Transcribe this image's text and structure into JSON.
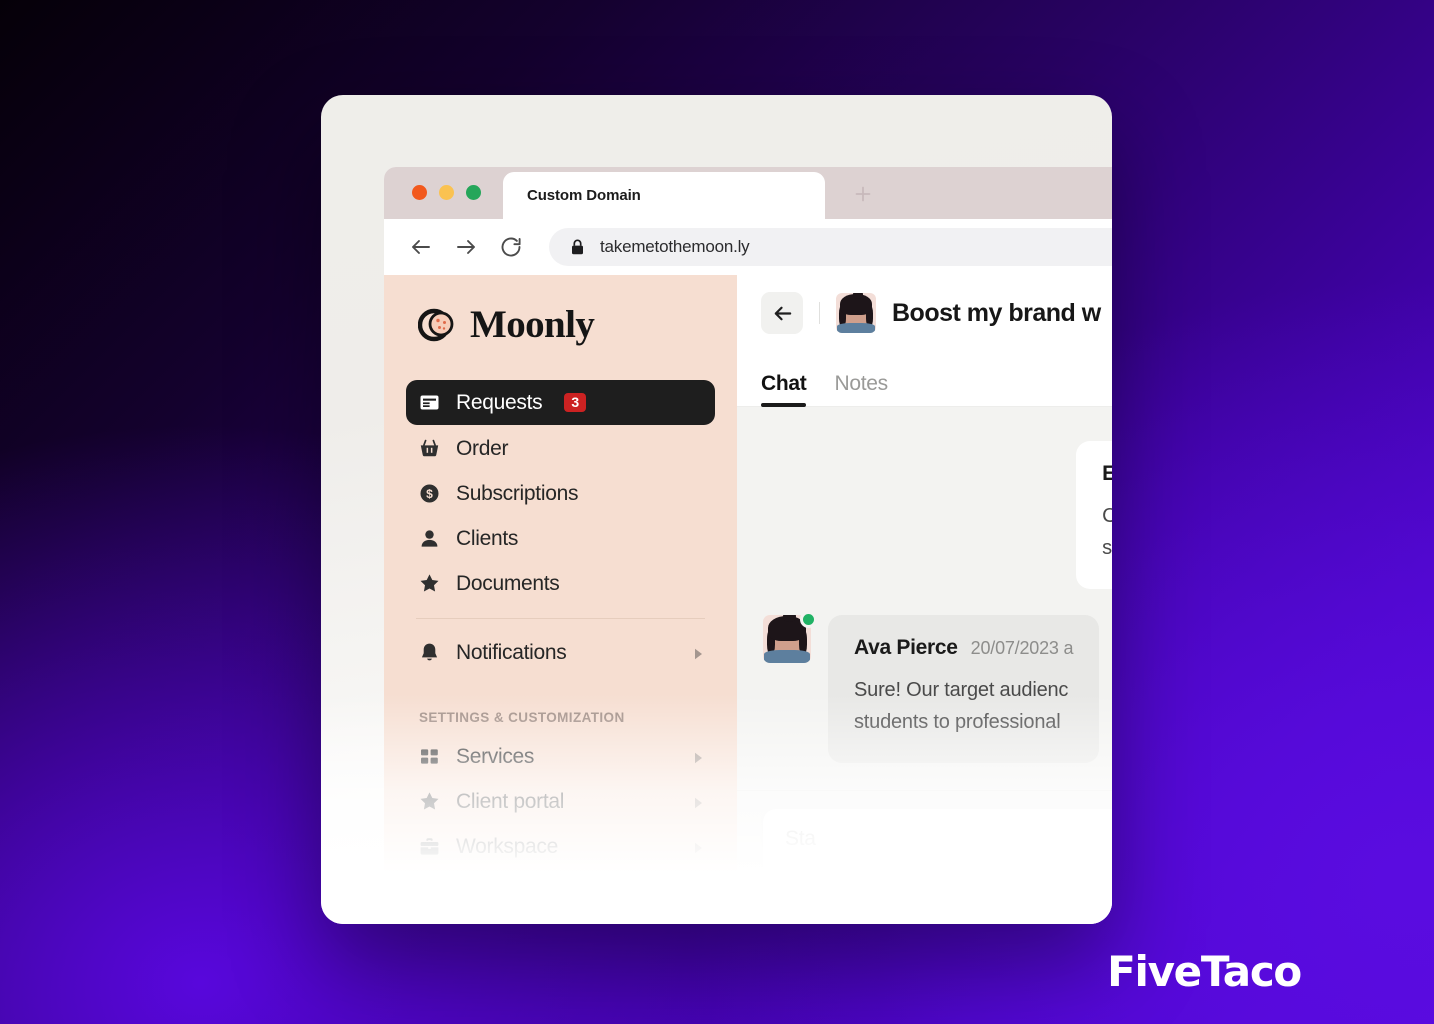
{
  "background": {
    "gradient_from": "#050008",
    "gradient_to": "#5707de"
  },
  "watermark": {
    "text": "FiveTaco"
  },
  "browser": {
    "traffic_lights": [
      "close-red",
      "minimize-yellow",
      "maximize-green"
    ],
    "tab": {
      "title": "Custom Domain",
      "new_tab_label": "+"
    },
    "toolbar": {
      "back_label": "Back",
      "forward_label": "Forward",
      "reload_label": "Reload"
    },
    "omnibox": {
      "url": "takemetothemoon.ly",
      "secure": true
    }
  },
  "sidebar": {
    "brand": {
      "name": "Moonly"
    },
    "items": [
      {
        "label": "Requests",
        "icon": "requests-icon",
        "badge": "3",
        "active": true,
        "caret": false
      },
      {
        "label": "Order",
        "icon": "basket-icon",
        "badge": null,
        "active": false,
        "caret": false
      },
      {
        "label": "Subscriptions",
        "icon": "dollar-circle-icon",
        "badge": null,
        "active": false,
        "caret": false
      },
      {
        "label": "Clients",
        "icon": "person-icon",
        "badge": null,
        "active": false,
        "caret": false
      },
      {
        "label": "Documents",
        "icon": "star-icon",
        "badge": null,
        "active": false,
        "caret": false
      }
    ],
    "items_after_divider": [
      {
        "label": "Notifications",
        "icon": "bell-icon",
        "badge": null,
        "active": false,
        "caret": true
      }
    ],
    "section_label": "SETTINGS & CUSTOMIZATION",
    "settings_items": [
      {
        "label": "Services",
        "icon": "grid-icon",
        "badge": null,
        "active": false,
        "caret": true
      },
      {
        "label": "Client portal",
        "icon": "star-icon",
        "badge": null,
        "active": false,
        "caret": true
      },
      {
        "label": "Workspace",
        "icon": "briefcase-icon",
        "badge": null,
        "active": false,
        "caret": true
      }
    ],
    "accent_background": "#f6ded1",
    "badge_color": "#cc2222"
  },
  "conversation": {
    "back_button_label": "Back",
    "title": "Boost my brand w",
    "avatar_alt": "Ava Pierce avatar",
    "tabs": [
      {
        "label": "Chat",
        "selected": true
      },
      {
        "label": "Notes",
        "selected": false
      }
    ],
    "messages": [
      {
        "author": "Ethan Davis",
        "timestamp": "",
        "text": "Could you t\nstart?",
        "direction": "out",
        "has_avatar": false,
        "online": false
      },
      {
        "author": "Ava Pierce",
        "timestamp": "20/07/2023 a",
        "text": "Sure! Our target audienc\nstudents to professional",
        "direction": "in",
        "has_avatar": true,
        "online": true
      }
    ],
    "composer": {
      "placeholder": "Sta"
    }
  }
}
